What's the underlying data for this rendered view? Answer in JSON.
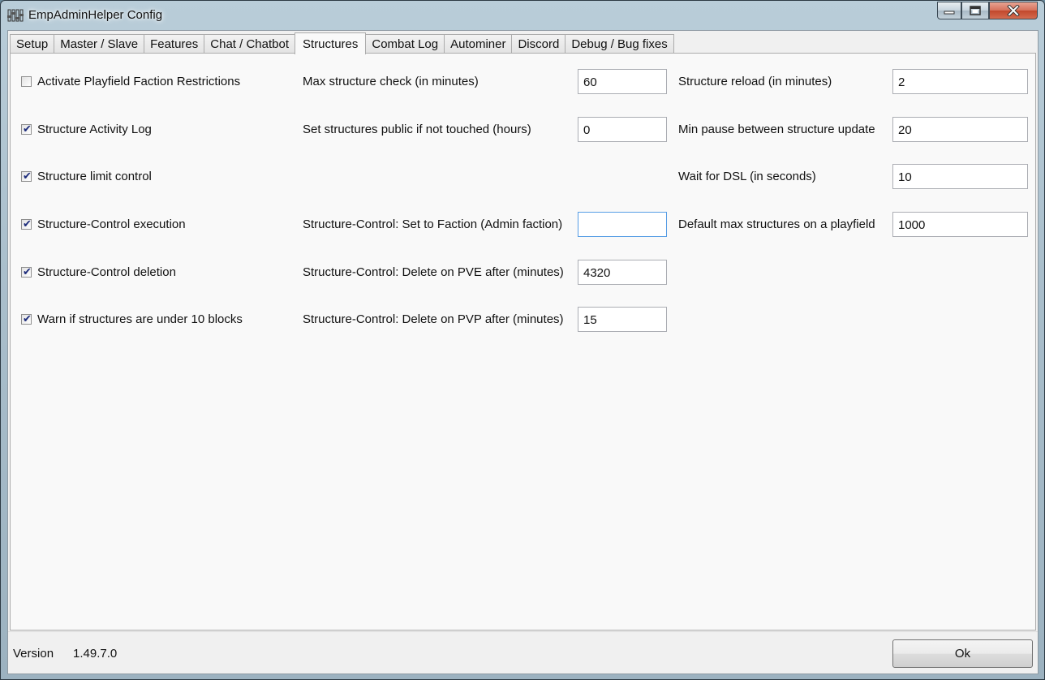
{
  "window": {
    "title": "EmpAdminHelper Config"
  },
  "colors": {
    "checkmark": "#1b2a7a",
    "focus_border": "#569de5",
    "close_button": "#c1472c"
  },
  "tabs": [
    {
      "label": "Setup",
      "active": false
    },
    {
      "label": "Master / Slave",
      "active": false
    },
    {
      "label": "Features",
      "active": false
    },
    {
      "label": "Chat / Chatbot",
      "active": false
    },
    {
      "label": "Structures",
      "active": true
    },
    {
      "label": "Combat Log",
      "active": false
    },
    {
      "label": "Autominer",
      "active": false
    },
    {
      "label": "Discord",
      "active": false
    },
    {
      "label": "Debug / Bug fixes",
      "active": false
    }
  ],
  "checkboxes": [
    {
      "label": "Activate Playfield Faction Restrictions",
      "checked": false
    },
    {
      "label": "Structure Activity Log",
      "checked": true
    },
    {
      "label": "Structure limit control",
      "checked": true
    },
    {
      "label": "Structure-Control execution",
      "checked": true
    },
    {
      "label": "Structure-Control deletion",
      "checked": true
    },
    {
      "label": "Warn if structures are under 10 blocks",
      "checked": true
    }
  ],
  "middle_fields": [
    {
      "label": "Max structure check (in minutes)",
      "value": "60"
    },
    {
      "label": "Set structures public if not touched (hours)",
      "value": "0"
    },
    {
      "label": "Structure-Control: Set to Faction (Admin faction)",
      "value": ""
    },
    {
      "label": "Structure-Control: Delete on PVE after (minutes)",
      "value": "4320"
    },
    {
      "label": "Structure-Control: Delete on PVP after (minutes)",
      "value": "15"
    }
  ],
  "right_fields": [
    {
      "label": "Structure reload (in minutes)",
      "value": "2"
    },
    {
      "label": "Min pause between structure update",
      "value": "20"
    },
    {
      "label": "Wait for DSL (in seconds)",
      "value": "10"
    },
    {
      "label": "Default max structures on a playfield",
      "value": "1000"
    }
  ],
  "footer": {
    "version_label": "Version",
    "version_value": "1.49.7.0",
    "ok_label": "Ok"
  },
  "check_glyph": "✔"
}
